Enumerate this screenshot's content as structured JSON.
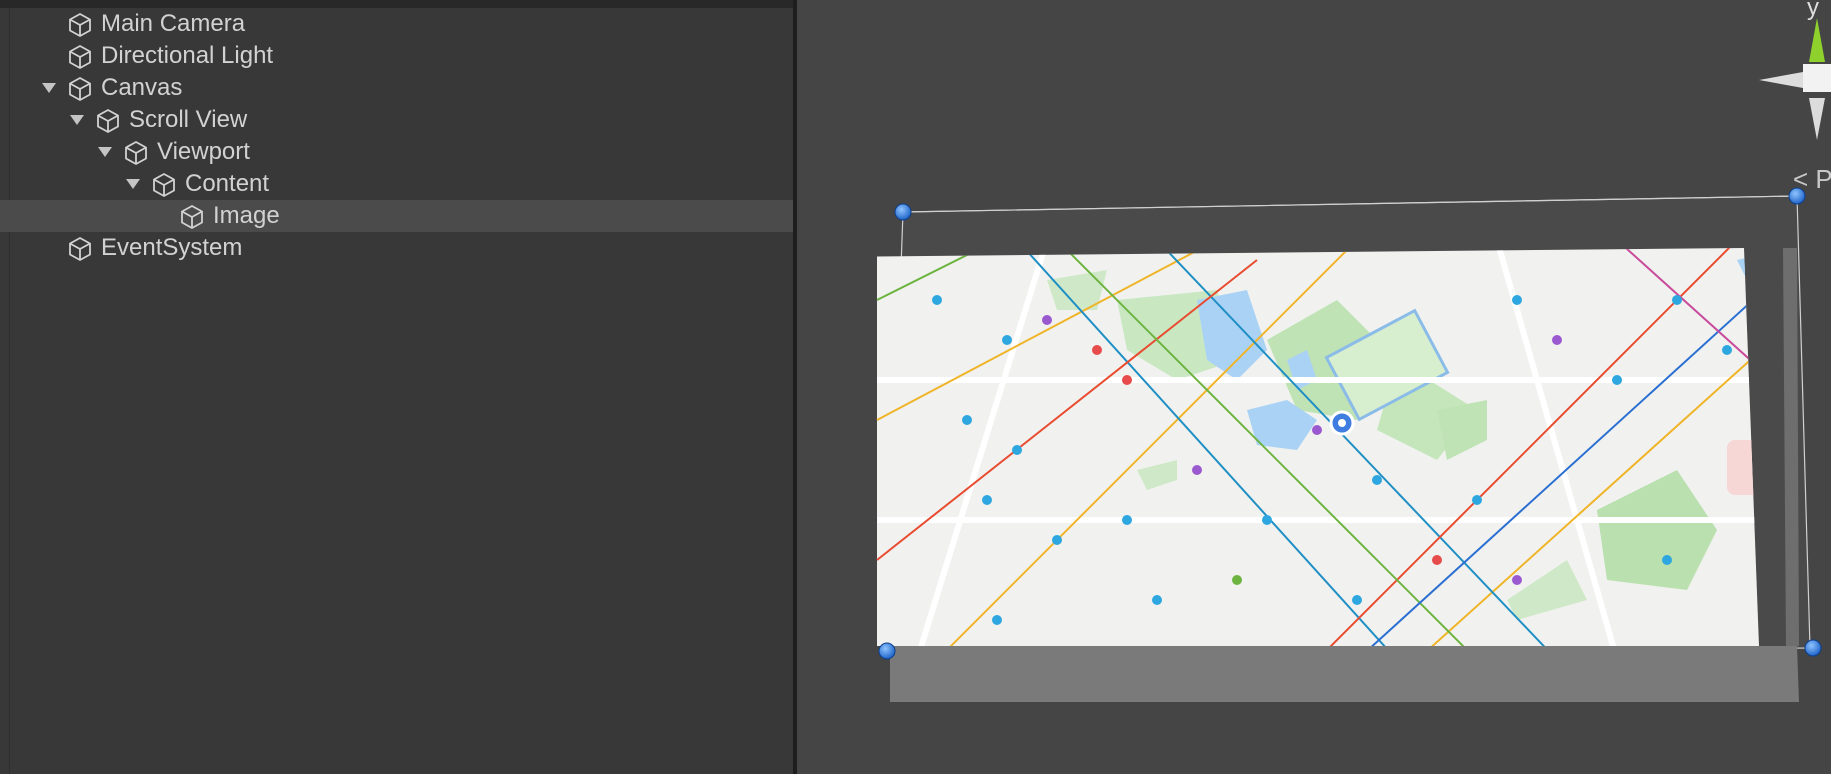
{
  "hierarchy": {
    "items": [
      {
        "label": "Main Camera",
        "depth": 0,
        "expanded": null,
        "selected": false
      },
      {
        "label": "Directional Light",
        "depth": 0,
        "expanded": null,
        "selected": false
      },
      {
        "label": "Canvas",
        "depth": 0,
        "expanded": true,
        "selected": false
      },
      {
        "label": "Scroll View",
        "depth": 1,
        "expanded": true,
        "selected": false
      },
      {
        "label": "Viewport",
        "depth": 2,
        "expanded": true,
        "selected": false
      },
      {
        "label": "Content",
        "depth": 3,
        "expanded": true,
        "selected": false
      },
      {
        "label": "Image",
        "depth": 4,
        "expanded": null,
        "selected": true
      },
      {
        "label": "EventSystem",
        "depth": 0,
        "expanded": null,
        "selected": false
      }
    ]
  },
  "scene": {
    "projection_label": "< Per",
    "gizmo_y_label": "y",
    "selected_object": "Image",
    "map_content": "city map image (Beijing area)"
  },
  "colors": {
    "panel_bg": "#383838",
    "scene_bg": "#454545",
    "selection_bg": "#4b4b4b",
    "handle_blue": "#2f7fe0",
    "gizmo_green": "#8ed12c",
    "map_bg": "#f1f2f0",
    "park_green": "#bfe3b5",
    "water_blue": "#a9d2f5"
  },
  "icons": {
    "hierarchy_object": "cube-icon",
    "foldout": "triangle-down-icon",
    "scene_gizmo": "axis-gizmo-icon"
  }
}
